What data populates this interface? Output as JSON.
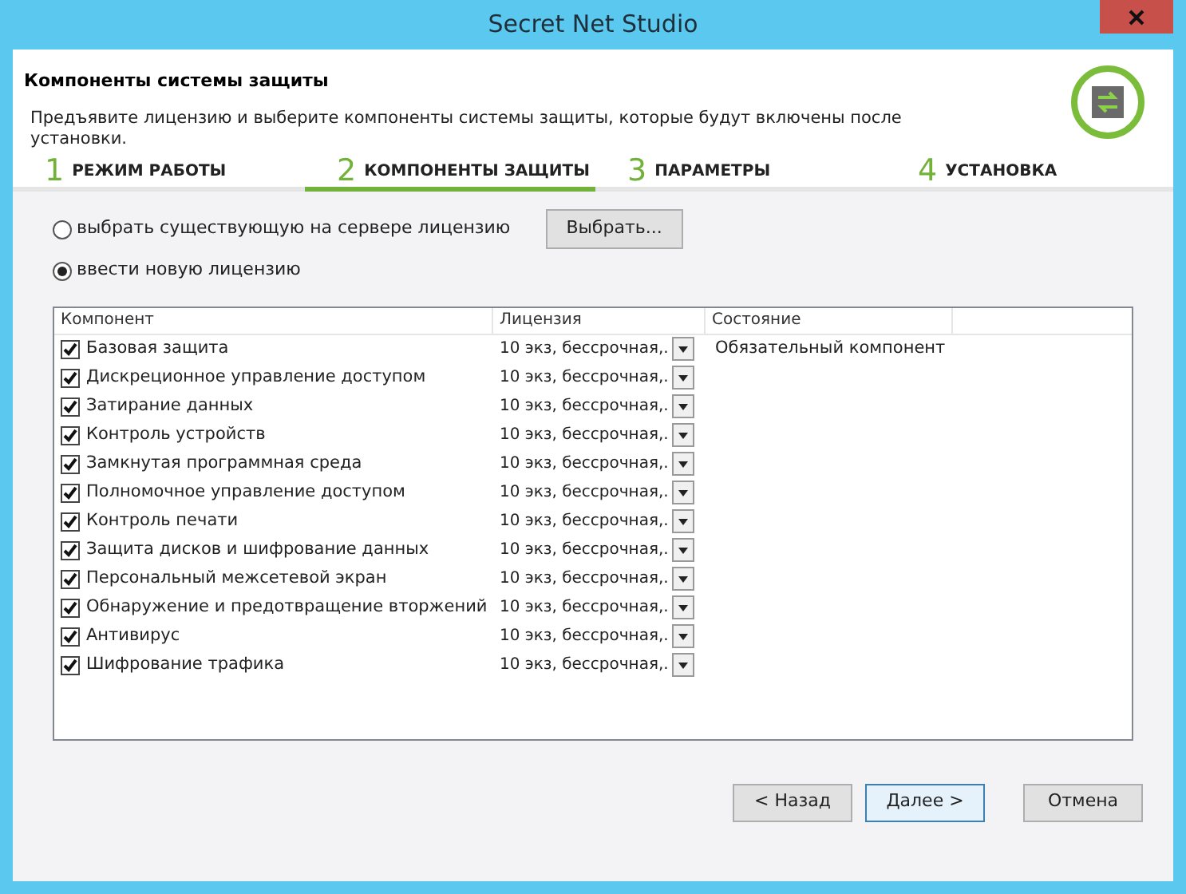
{
  "window": {
    "title": "Secret Net Studio"
  },
  "header": {
    "title": "Компоненты системы защиты",
    "description": "Предъявите лицензию и выберите компоненты системы защиты, которые будут включены после установки."
  },
  "steps": [
    {
      "number": "1",
      "label": "РЕЖИМ РАБОТЫ",
      "selected": false
    },
    {
      "number": "2",
      "label": "КОМПОНЕНТЫ ЗАЩИТЫ",
      "selected": true
    },
    {
      "number": "3",
      "label": "ПАРАМЕТРЫ",
      "selected": false
    },
    {
      "number": "4",
      "label": "УСТАНОВКА",
      "selected": false
    }
  ],
  "license_options": [
    {
      "label": "выбрать существующую на сервере лицензию",
      "selected": false,
      "button": "Выбрать..."
    },
    {
      "label": "ввести новую лицензию",
      "selected": true
    }
  ],
  "table": {
    "columns": [
      "Компонент",
      "Лицензия",
      "Состояние"
    ],
    "rows": [
      {
        "name": "Базовая защита",
        "checked": true,
        "license": "10 экз, бессрочная,.",
        "state": "Обязательный компонент"
      },
      {
        "name": "Дискреционное управление доступом",
        "checked": true,
        "license": "10 экз, бессрочная,."
      },
      {
        "name": "Затирание данных",
        "checked": true,
        "license": "10 экз, бессрочная,."
      },
      {
        "name": "Контроль устройств",
        "checked": true,
        "license": "10 экз, бессрочная,."
      },
      {
        "name": "Замкнутая программная среда",
        "checked": true,
        "license": "10 экз, бессрочная,."
      },
      {
        "name": "Полномочное управление доступом",
        "checked": true,
        "license": "10 экз, бессрочная,."
      },
      {
        "name": "Контроль печати",
        "checked": true,
        "license": "10 экз, бессрочная,."
      },
      {
        "name": "Защита дисков и шифрование данных",
        "checked": true,
        "license": "10 экз, бессрочная,."
      },
      {
        "name": "Персональный межсетевой экран",
        "checked": true,
        "license": "10 экз, бессрочная,."
      },
      {
        "name": "Обнаружение и предотвращение вторжений",
        "checked": true,
        "license": "10 экз, бессрочная,."
      },
      {
        "name": "Антивирус",
        "checked": true,
        "license": "10 экз, бессрочная,."
      },
      {
        "name": "Шифрование трафика",
        "checked": true,
        "license": "10 экз, бессрочная,."
      }
    ]
  },
  "buttons": [
    {
      "label": "< Назад",
      "focused": false
    },
    {
      "label": "Далее >",
      "focused": true
    },
    {
      "label": "Отмена",
      "focused": false
    }
  ]
}
